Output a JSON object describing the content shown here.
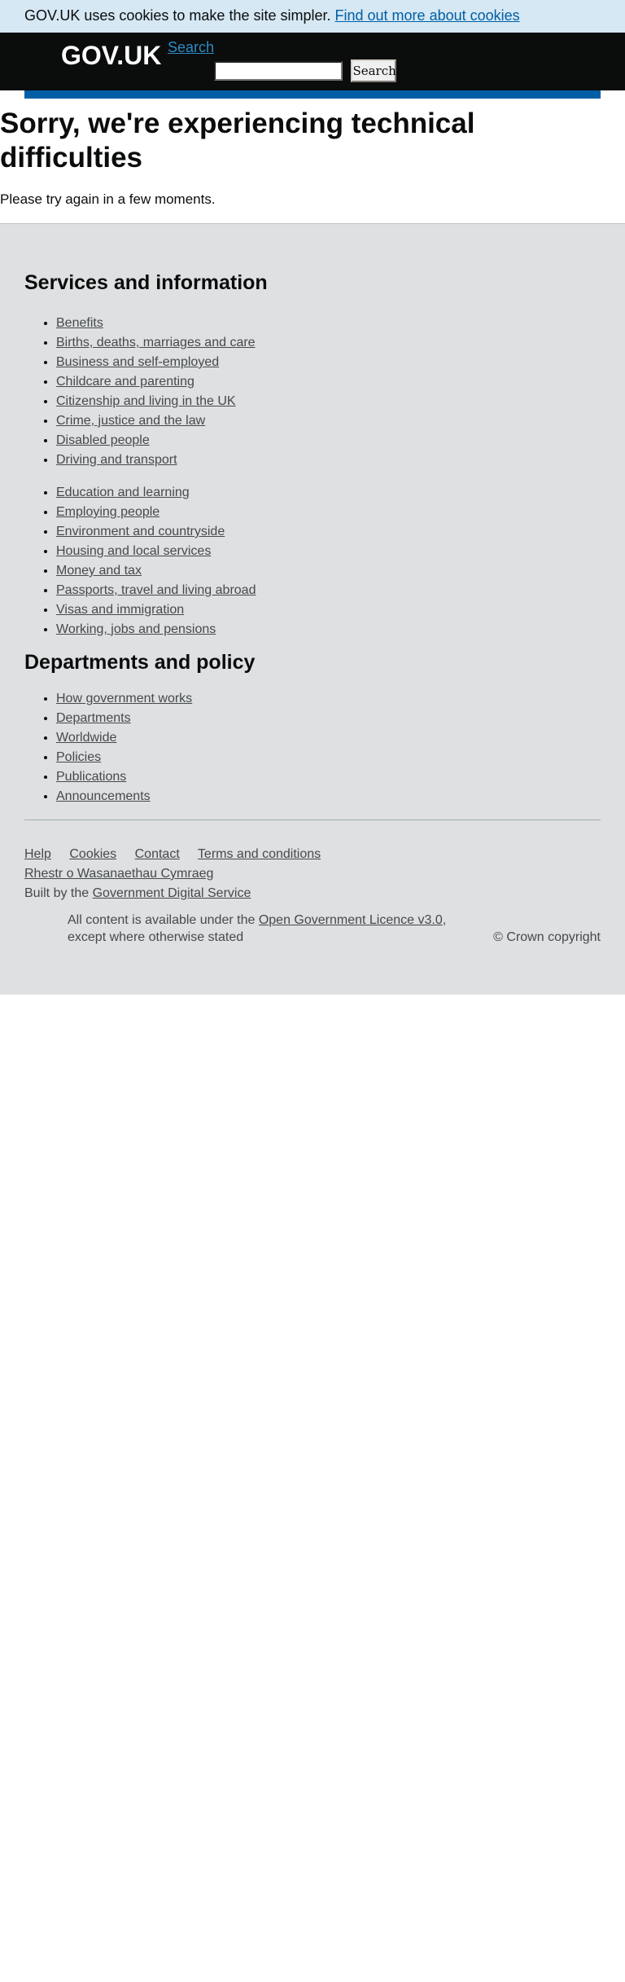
{
  "cookie_banner": {
    "text": "GOV.UK uses cookies to make the site simpler.",
    "link_text": "Find out more about cookies"
  },
  "header": {
    "logo_text": "GOV.UK",
    "search_link": "Search",
    "search_input_value": "",
    "search_button": "Search"
  },
  "main": {
    "title": "Sorry, we're experiencing technical difficulties",
    "lede": "Please try again in a few moments."
  },
  "footer": {
    "services_title": "Services and information",
    "services_list_1": [
      "Benefits",
      "Births, deaths, marriages and care",
      "Business and self-employed",
      "Childcare and parenting",
      "Citizenship and living in the UK",
      "Crime, justice and the law",
      "Disabled people",
      "Driving and transport"
    ],
    "services_list_2": [
      "Education and learning",
      "Employing people",
      "Environment and countryside",
      "Housing and local services",
      "Money and tax",
      "Passports, travel and living abroad",
      "Visas and immigration",
      "Working, jobs and pensions"
    ],
    "departments_title": "Departments and policy",
    "departments_list": [
      "How government works",
      "Departments",
      "Worldwide",
      "Policies",
      "Publications",
      "Announcements"
    ],
    "support_links": [
      "Help",
      "Cookies",
      "Contact",
      "Terms and conditions"
    ],
    "welsh_link": "Rhestr o Wasanaethau Cymraeg",
    "built_by_prefix": "Built by the",
    "built_by_link": "Government Digital Service",
    "licence_prefix": "All content is available under the",
    "licence_link": "Open Government Licence v3.0",
    "licence_suffix": ",",
    "licence_line2": "except where otherwise stated",
    "copyright": "© Crown copyright"
  },
  "colors": {
    "cookie_banner_bg": "#d5e8f3",
    "header_bg": "#0b0c0c",
    "brand_blue": "#005ea5",
    "footer_bg": "#dee0e2",
    "link": "#454a4c"
  }
}
